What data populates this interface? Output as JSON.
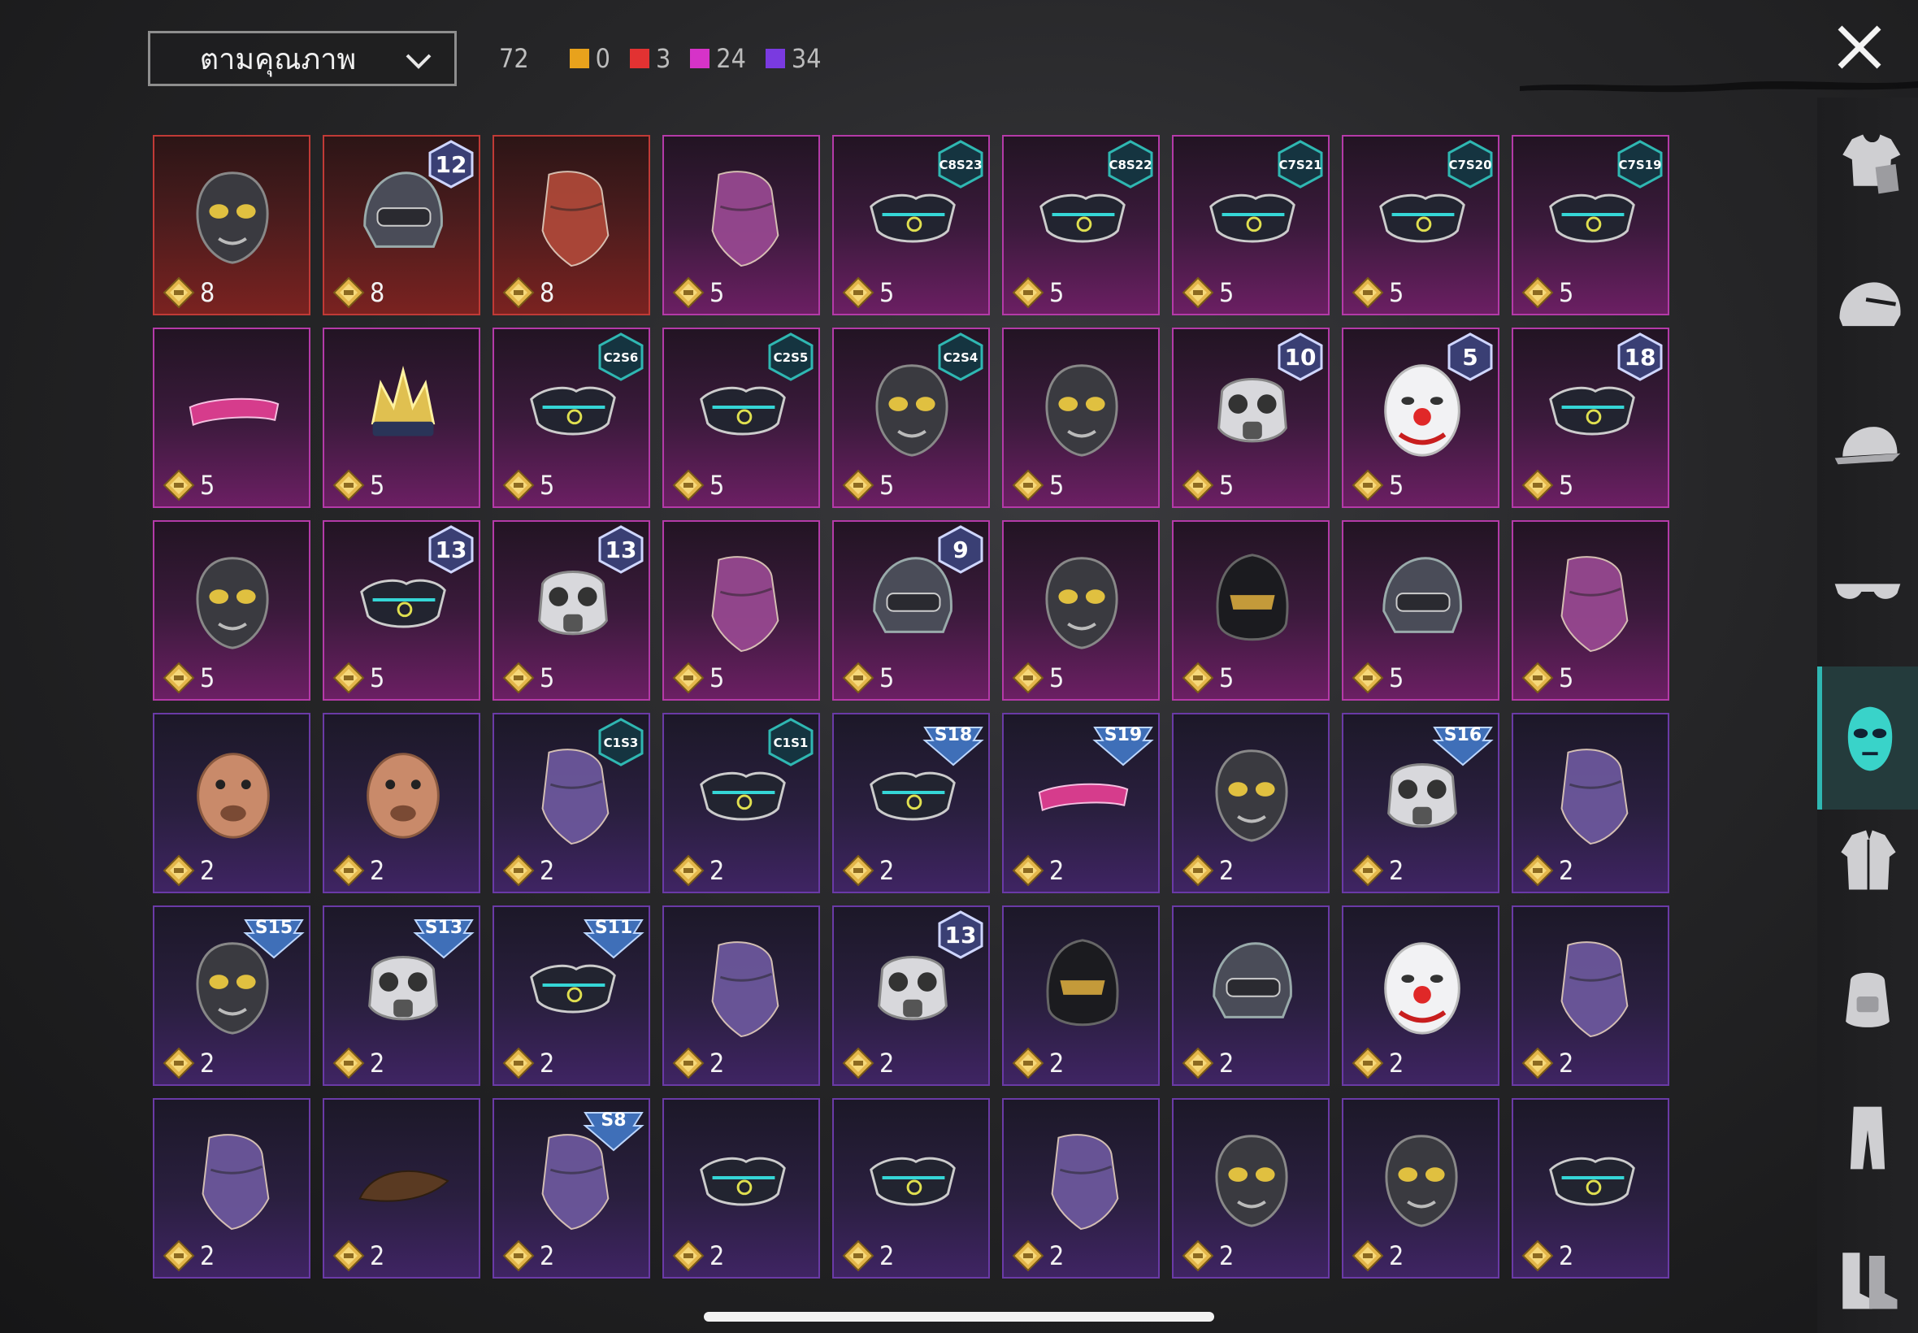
{
  "sort": {
    "label": "ตามคุณภาพ"
  },
  "counts": {
    "total": "72",
    "rarities": [
      {
        "name": "orange",
        "color": "#e8a21c",
        "value": "0"
      },
      {
        "name": "red",
        "color": "#e23232",
        "value": "3"
      },
      {
        "name": "pink",
        "color": "#d633c8",
        "value": "24"
      },
      {
        "name": "purple",
        "color": "#7a3ae0",
        "value": "34"
      }
    ]
  },
  "items": [
    {
      "rarity": "red",
      "cost": "8",
      "badge": "",
      "art": "mask"
    },
    {
      "rarity": "red",
      "cost": "8",
      "badge": "12",
      "badge_type": "level",
      "art": "helmet"
    },
    {
      "rarity": "red",
      "cost": "8",
      "badge": "",
      "art": "scarf"
    },
    {
      "rarity": "pink",
      "cost": "5",
      "badge": "",
      "art": "scarf"
    },
    {
      "rarity": "pink",
      "cost": "5",
      "badge": "C8S23",
      "badge_type": "code",
      "art": "halfmask"
    },
    {
      "rarity": "pink",
      "cost": "5",
      "badge": "C8S22",
      "badge_type": "code",
      "art": "halfmask"
    },
    {
      "rarity": "pink",
      "cost": "5",
      "badge": "C7S21",
      "badge_type": "code",
      "art": "halfmask"
    },
    {
      "rarity": "pink",
      "cost": "5",
      "badge": "C7S20",
      "badge_type": "code",
      "art": "halfmask"
    },
    {
      "rarity": "pink",
      "cost": "5",
      "badge": "C7S19",
      "badge_type": "code",
      "art": "halfmask"
    },
    {
      "rarity": "pink",
      "cost": "5",
      "badge": "",
      "art": "visor"
    },
    {
      "rarity": "pink",
      "cost": "5",
      "badge": "",
      "art": "crown"
    },
    {
      "rarity": "pink",
      "cost": "5",
      "badge": "C2S6",
      "badge_type": "code",
      "art": "halfmask"
    },
    {
      "rarity": "pink",
      "cost": "5",
      "badge": "C2S5",
      "badge_type": "code",
      "art": "halfmask"
    },
    {
      "rarity": "pink",
      "cost": "5",
      "badge": "C2S4",
      "badge_type": "code",
      "art": "mask"
    },
    {
      "rarity": "pink",
      "cost": "5",
      "badge": "",
      "art": "mask"
    },
    {
      "rarity": "pink",
      "cost": "5",
      "badge": "10",
      "badge_type": "level",
      "art": "gasmask"
    },
    {
      "rarity": "pink",
      "cost": "5",
      "badge": "5",
      "badge_type": "level",
      "art": "clown"
    },
    {
      "rarity": "pink",
      "cost": "5",
      "badge": "18",
      "badge_type": "level",
      "art": "halfmask"
    },
    {
      "rarity": "pink",
      "cost": "5",
      "badge": "",
      "art": "mask"
    },
    {
      "rarity": "pink",
      "cost": "5",
      "badge": "13",
      "badge_type": "level",
      "art": "halfmask"
    },
    {
      "rarity": "pink",
      "cost": "5",
      "badge": "13",
      "badge_type": "level",
      "art": "gasmask"
    },
    {
      "rarity": "pink",
      "cost": "5",
      "badge": "",
      "art": "scarf"
    },
    {
      "rarity": "pink",
      "cost": "5",
      "badge": "9",
      "badge_type": "level",
      "art": "helmet"
    },
    {
      "rarity": "pink",
      "cost": "5",
      "badge": "",
      "art": "mask"
    },
    {
      "rarity": "pink",
      "cost": "5",
      "badge": "",
      "art": "hood"
    },
    {
      "rarity": "pink",
      "cost": "5",
      "badge": "",
      "art": "helmet"
    },
    {
      "rarity": "pink",
      "cost": "5",
      "badge": "",
      "art": "scarf"
    },
    {
      "rarity": "purple",
      "cost": "2",
      "badge": "",
      "art": "animal"
    },
    {
      "rarity": "purple",
      "cost": "2",
      "badge": "",
      "art": "animal"
    },
    {
      "rarity": "purple",
      "cost": "2",
      "badge": "C1S3",
      "badge_type": "code",
      "art": "scarf"
    },
    {
      "rarity": "purple",
      "cost": "2",
      "badge": "C1S1",
      "badge_type": "code",
      "art": "halfmask"
    },
    {
      "rarity": "purple",
      "cost": "2",
      "badge": "S18",
      "badge_type": "season",
      "art": "halfmask"
    },
    {
      "rarity": "purple",
      "cost": "2",
      "badge": "S19",
      "badge_type": "season",
      "art": "visor"
    },
    {
      "rarity": "purple",
      "cost": "2",
      "badge": "",
      "art": "mask"
    },
    {
      "rarity": "purple",
      "cost": "2",
      "badge": "S16",
      "badge_type": "season",
      "art": "gasmask"
    },
    {
      "rarity": "purple",
      "cost": "2",
      "badge": "",
      "art": "scarf"
    },
    {
      "rarity": "purple",
      "cost": "2",
      "badge": "S15",
      "badge_type": "season",
      "art": "mask"
    },
    {
      "rarity": "purple",
      "cost": "2",
      "badge": "S13",
      "badge_type": "season",
      "art": "gasmask"
    },
    {
      "rarity": "purple",
      "cost": "2",
      "badge": "S11",
      "badge_type": "season",
      "art": "halfmask"
    },
    {
      "rarity": "purple",
      "cost": "2",
      "badge": "",
      "art": "scarf"
    },
    {
      "rarity": "purple",
      "cost": "2",
      "badge": "13",
      "badge_type": "level",
      "art": "gasmask"
    },
    {
      "rarity": "purple",
      "cost": "2",
      "badge": "",
      "art": "hood"
    },
    {
      "rarity": "purple",
      "cost": "2",
      "badge": "",
      "art": "helmet"
    },
    {
      "rarity": "purple",
      "cost": "2",
      "badge": "",
      "art": "clown"
    },
    {
      "rarity": "purple",
      "cost": "2",
      "badge": "",
      "art": "scarf"
    },
    {
      "rarity": "purple",
      "cost": "2",
      "badge": "",
      "art": "scarf"
    },
    {
      "rarity": "purple",
      "cost": "2",
      "badge": "",
      "art": "hair"
    },
    {
      "rarity": "purple",
      "cost": "2",
      "badge": "S8",
      "badge_type": "season",
      "art": "scarf"
    },
    {
      "rarity": "purple",
      "cost": "2",
      "badge": "",
      "art": "halfmask"
    },
    {
      "rarity": "purple",
      "cost": "2",
      "badge": "",
      "art": "halfmask"
    },
    {
      "rarity": "purple",
      "cost": "2",
      "badge": "",
      "art": "scarf"
    },
    {
      "rarity": "purple",
      "cost": "2",
      "badge": "",
      "art": "mask"
    },
    {
      "rarity": "purple",
      "cost": "2",
      "badge": "",
      "art": "mask"
    },
    {
      "rarity": "purple",
      "cost": "2",
      "badge": "",
      "art": "halfmask"
    }
  ],
  "sidebar": [
    {
      "name": "outfit",
      "icon": "shirt-icon",
      "active": false
    },
    {
      "name": "helmet",
      "icon": "helmet-icon",
      "active": false
    },
    {
      "name": "hat",
      "icon": "cap-icon",
      "active": false
    },
    {
      "name": "glasses",
      "icon": "glasses-icon",
      "active": false
    },
    {
      "name": "mask",
      "icon": "mask-icon",
      "active": true
    },
    {
      "name": "jacket",
      "icon": "jacket-icon",
      "active": false
    },
    {
      "name": "backpack",
      "icon": "backpack-icon",
      "active": false
    },
    {
      "name": "pants",
      "icon": "pants-icon",
      "active": false
    },
    {
      "name": "shoes",
      "icon": "boots-icon",
      "active": false
    }
  ]
}
